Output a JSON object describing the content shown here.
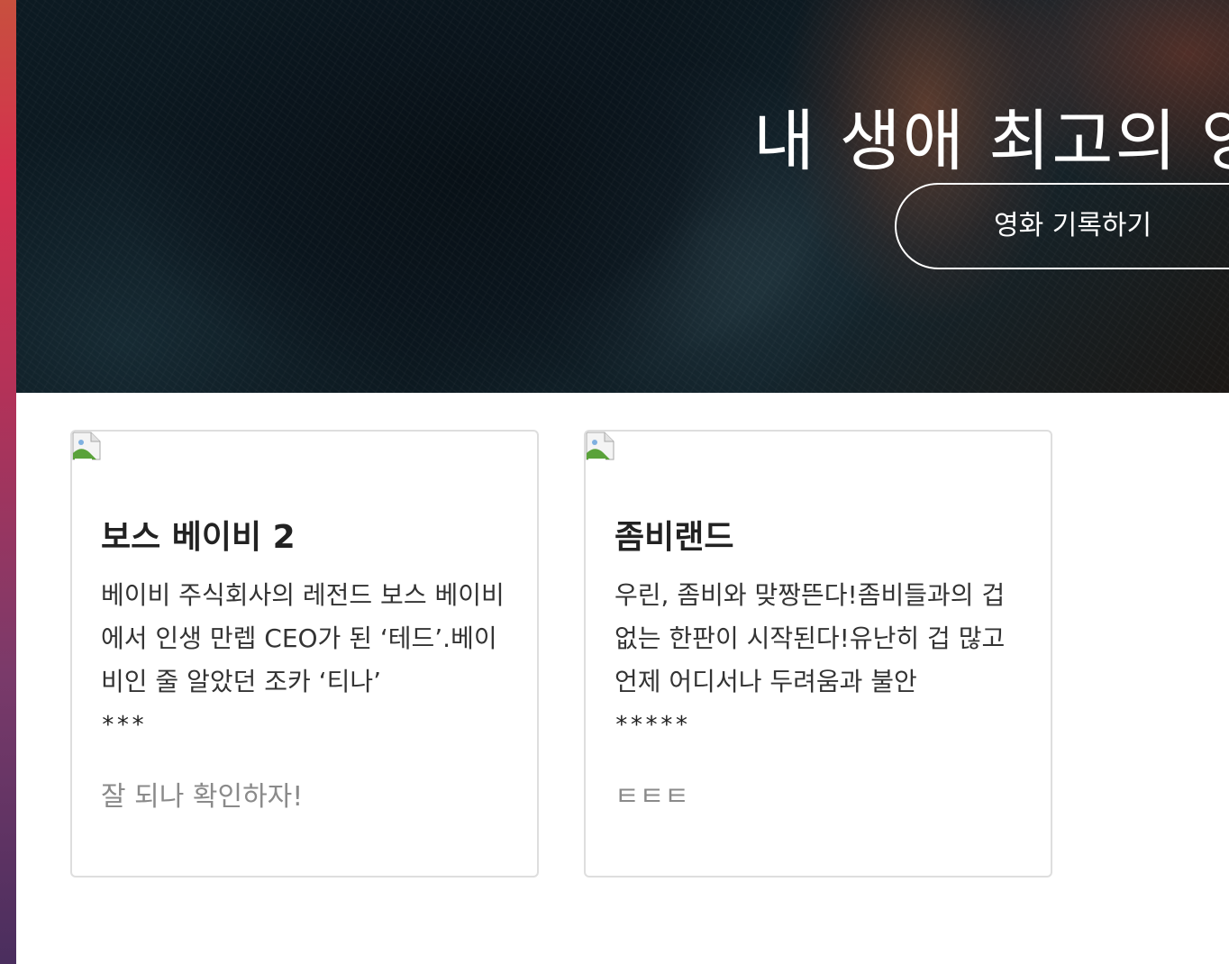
{
  "hero": {
    "title": "내 생애 최고의 영",
    "button_label": "영화 기록하기"
  },
  "cards": [
    {
      "title": "보스 베이비 2",
      "description": "베이비 주식회사의 레전드 보스 베이비에서 인생 만렙 CEO가 된 ‘테드’.베이비인 줄 알았던 조카 ‘티나’",
      "rating": "***",
      "comment": "잘 되나 확인하자!"
    },
    {
      "title": "좀비랜드",
      "description": "우린, 좀비와 맞짱뜬다!좀비들과의 겁없는 한판이 시작된다!유난히 겁 많고 언제 어디서나 두려움과 불안",
      "rating": "*****",
      "comment": "ㅌㅌㅌ"
    }
  ]
}
